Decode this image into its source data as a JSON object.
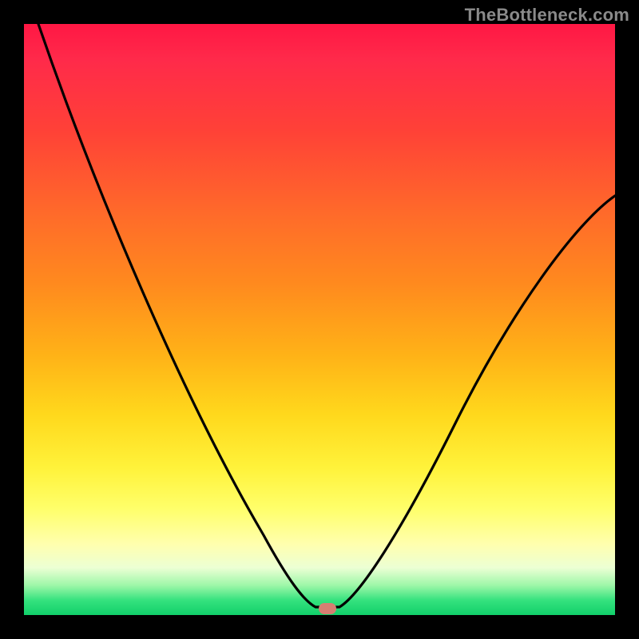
{
  "watermark": "TheBottleneck.com",
  "chart_data": {
    "type": "line",
    "title": "",
    "xlabel": "",
    "ylabel": "",
    "x_range": [
      0,
      100
    ],
    "y_range": [
      0,
      100
    ],
    "series": [
      {
        "name": "bottleneck-curve",
        "x": [
          2,
          10,
          20,
          30,
          40,
          46,
          49,
          50,
          51,
          53,
          56,
          60,
          70,
          80,
          90,
          100
        ],
        "values": [
          100,
          82,
          62,
          45,
          28,
          12,
          2,
          0,
          0,
          2,
          8,
          15,
          30,
          44,
          56,
          70
        ]
      }
    ],
    "marker": {
      "x": 50.5,
      "y": 0.7
    },
    "background_gradient": {
      "top": "#ff1744",
      "mid": "#ffd81c",
      "bottom": "#11d06a"
    }
  }
}
